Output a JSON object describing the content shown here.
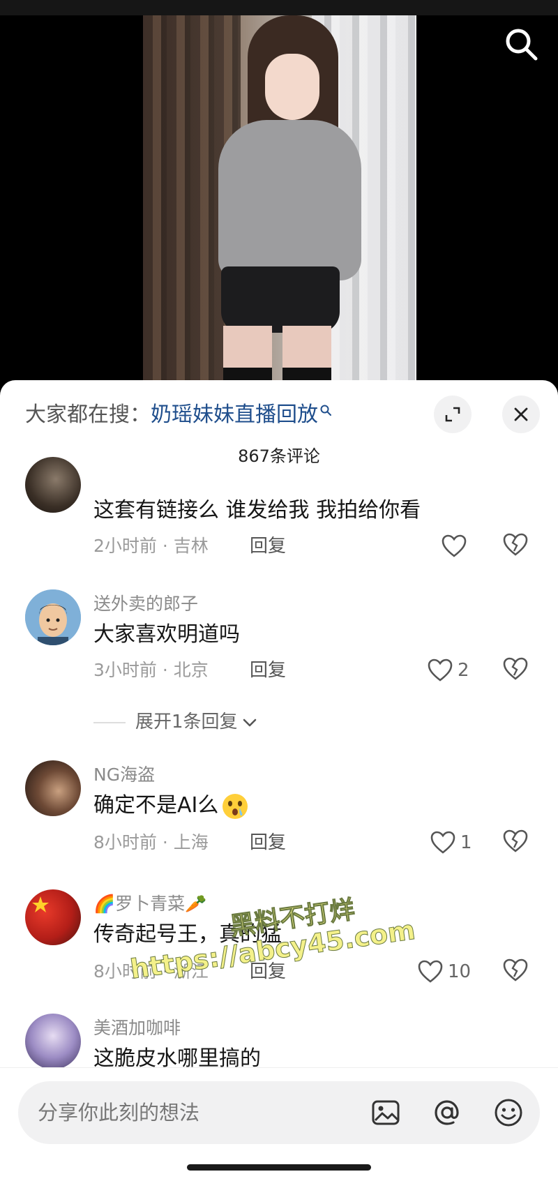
{
  "search_hint": {
    "prefix": "大家都在搜：",
    "query": "奶瑶妹妹直播回放"
  },
  "comments_header": {
    "count_label": "867条评论"
  },
  "comments": [
    {
      "username": "",
      "text": "这套有链接么  谁发给我  我拍给你看",
      "time_location": "2小时前 · 吉林",
      "reply_label": "回复",
      "likes": ""
    },
    {
      "username": "送外卖的郎子",
      "text": "大家喜欢明道吗",
      "time_location": "3小时前 · 北京",
      "reply_label": "回复",
      "likes": "2",
      "expand_label": "展开1条回复"
    },
    {
      "username": "NG海盗",
      "text": "确定不是AI么",
      "time_location": "8小时前 · 上海",
      "reply_label": "回复",
      "likes": "1"
    },
    {
      "username": "🌈罗卜青菜🥕",
      "text": "传奇起号王，真的猛",
      "time_location": "8小时前 · 浙江",
      "reply_label": "回复",
      "likes": "10"
    },
    {
      "username": "美酒加咖啡",
      "text": "这脆皮水哪里搞的"
    }
  ],
  "input_bar": {
    "placeholder": "分享你此刻的想法"
  },
  "watermark": {
    "line1": "黑料不打烊",
    "line2": "https://abcy45.com"
  },
  "icons": {
    "top_right": "search-icon",
    "sheet_controls": [
      "expand-icon",
      "close-icon"
    ],
    "comment_actions": [
      "heart-icon",
      "broken-heart-icon"
    ],
    "input_actions": [
      "image-icon",
      "at-icon",
      "emoji-icon"
    ]
  },
  "colors": {
    "link_blue": "#1f4e8c",
    "meta_gray": "#9a9a9a",
    "sheet_bg": "#ffffff",
    "input_bg": "#f1f1f2"
  }
}
